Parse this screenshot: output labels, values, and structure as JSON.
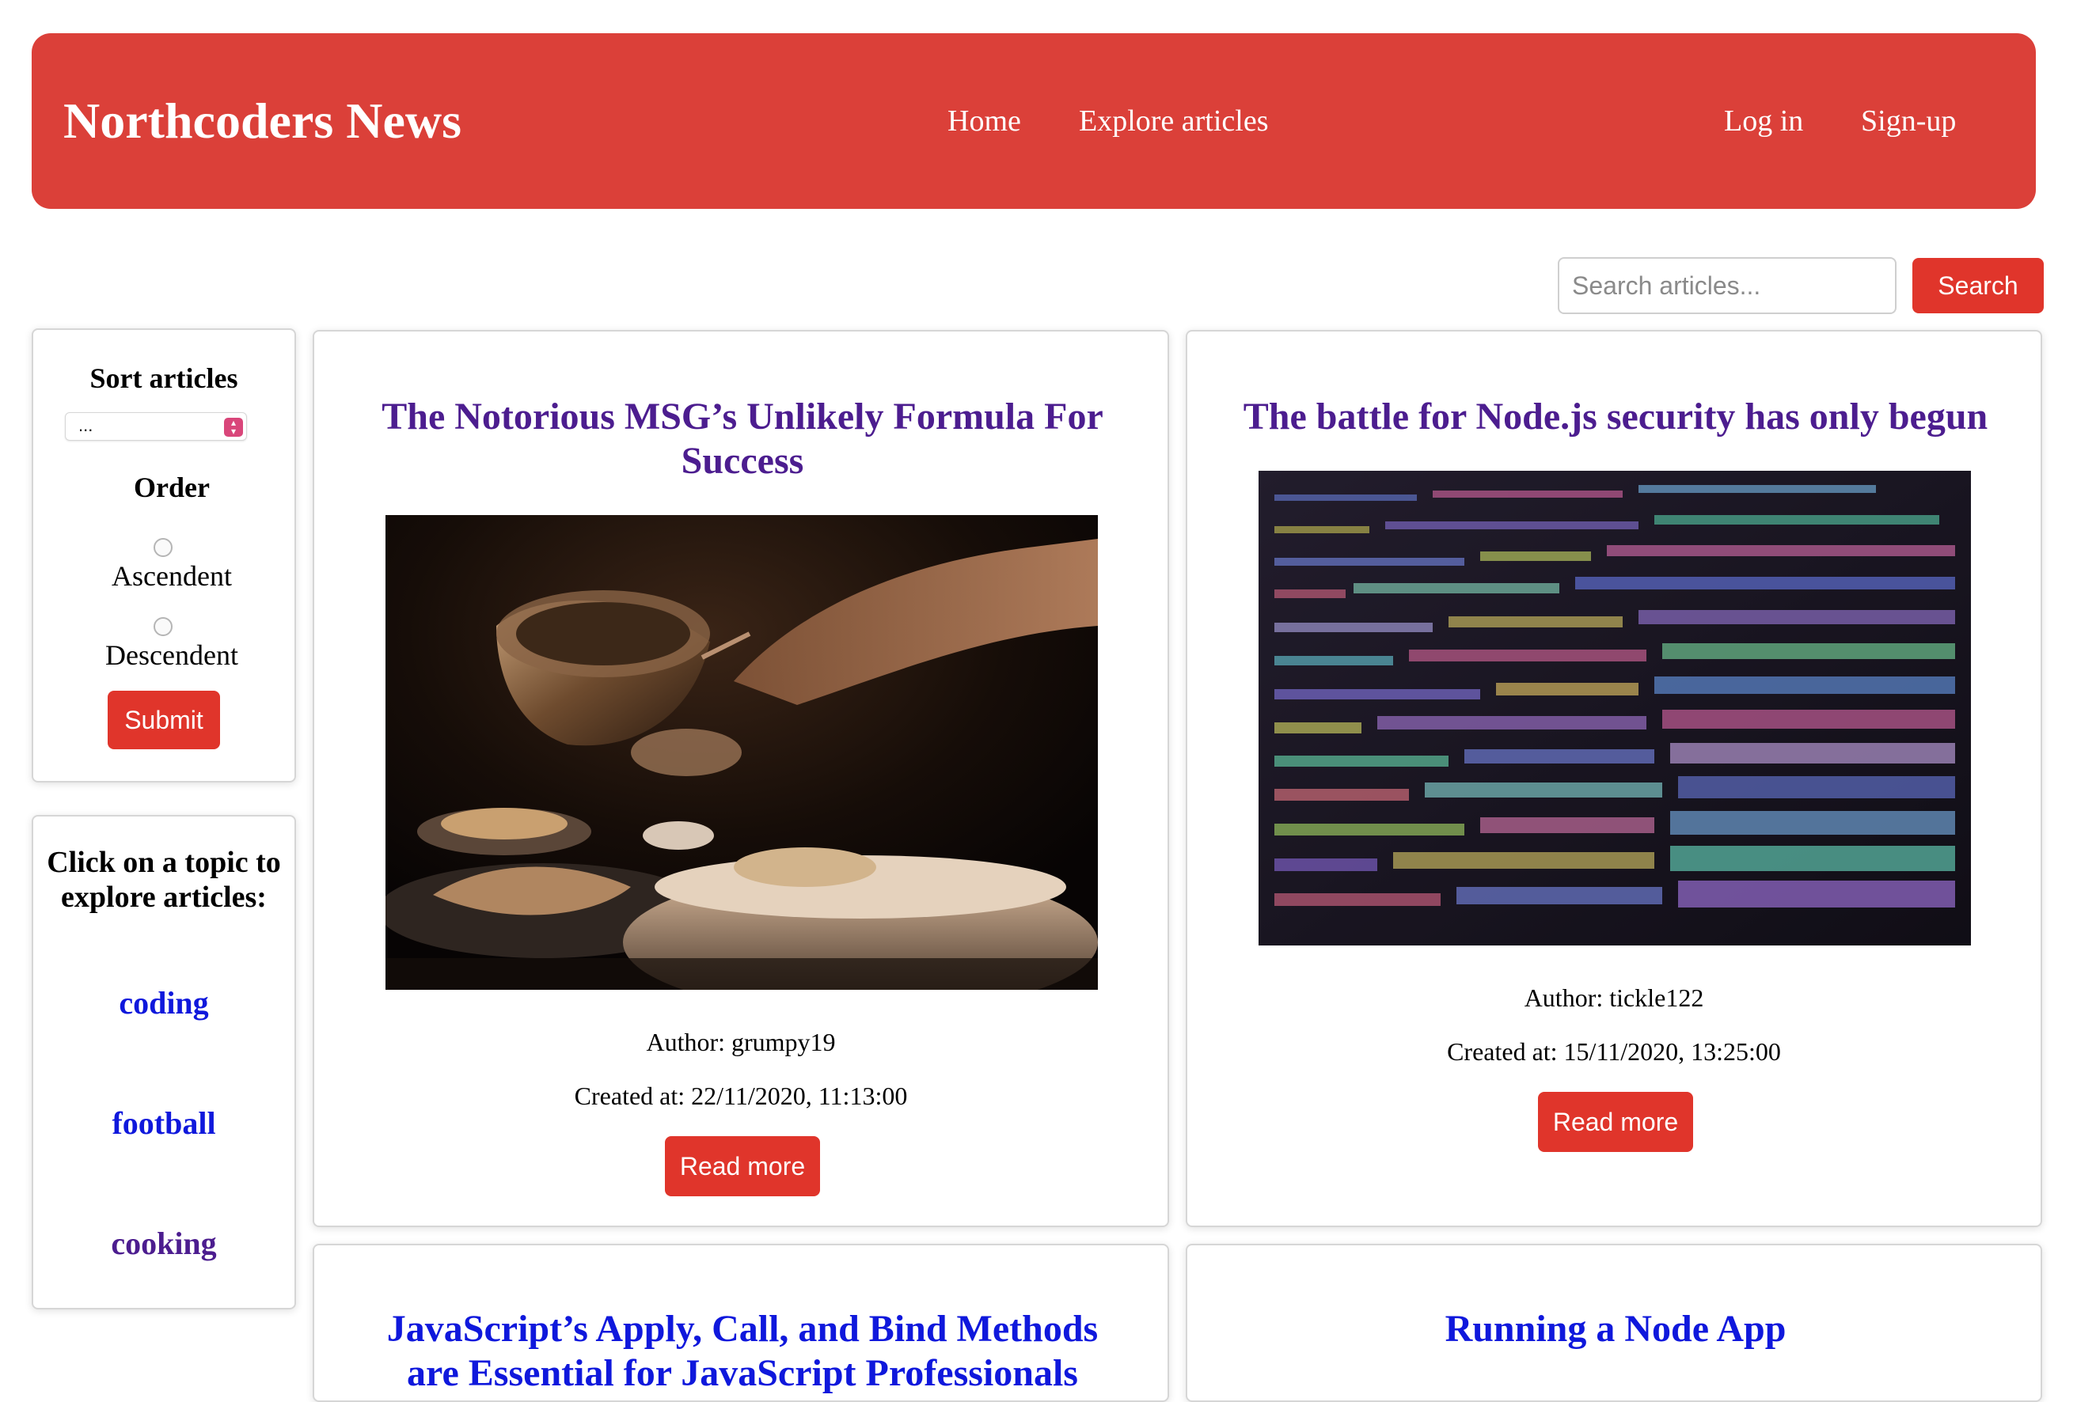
{
  "header": {
    "brand": "Northcoders News",
    "nav": {
      "home": "Home",
      "explore": "Explore articles",
      "login": "Log in",
      "signup": "Sign-up"
    },
    "color": "#db4039"
  },
  "search": {
    "placeholder": "Search articles...",
    "value": "",
    "button_label": "Search"
  },
  "sort": {
    "title": "Sort articles",
    "selected": "...",
    "order_title": "Order",
    "options": {
      "ascendent": "Ascendent",
      "descendent": "Descendent"
    },
    "submit_label": "Submit"
  },
  "topics": {
    "title": "Click on a topic to explore articles:",
    "items": [
      {
        "label": "coding",
        "visited": false
      },
      {
        "label": "football",
        "visited": false
      },
      {
        "label": "cooking",
        "visited": true
      }
    ]
  },
  "articles": [
    {
      "title": "The Notorious MSG’s Unlikely Formula For Success",
      "image": "cooking-photo",
      "author": "Author: grumpy19",
      "created": "Created at: 22/11/2020, 11:13:00",
      "read_more": "Read more"
    },
    {
      "title": "The battle for Node.js security has only begun",
      "image": "code-screen-photo",
      "author": "Author: tickle122",
      "created": "Created at: 15/11/2020, 13:25:00",
      "read_more": "Read more"
    },
    {
      "title": "JavaScript’s Apply, Call, and Bind Methods are Essential for JavaScript Professionals"
    },
    {
      "title": "Running a Node App"
    }
  ],
  "colors": {
    "accent": "#e0352b",
    "visited_link": "#4c1d8f",
    "link": "#0f18dc"
  }
}
